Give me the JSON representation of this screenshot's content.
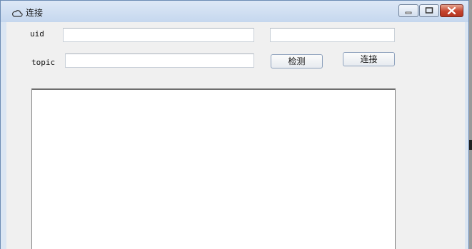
{
  "window": {
    "title": "连接",
    "title_icon": "cloud-icon",
    "controls": {
      "minimize": "minimize-icon",
      "maximize": "maximize-icon",
      "close": "close-icon"
    }
  },
  "form": {
    "uid_label": "uid",
    "uid_value": "",
    "uid_extra_value": "",
    "topic_label": "topic",
    "topic_value": "",
    "detect_button": "检测",
    "connect_button": "连接",
    "log_text": ""
  }
}
